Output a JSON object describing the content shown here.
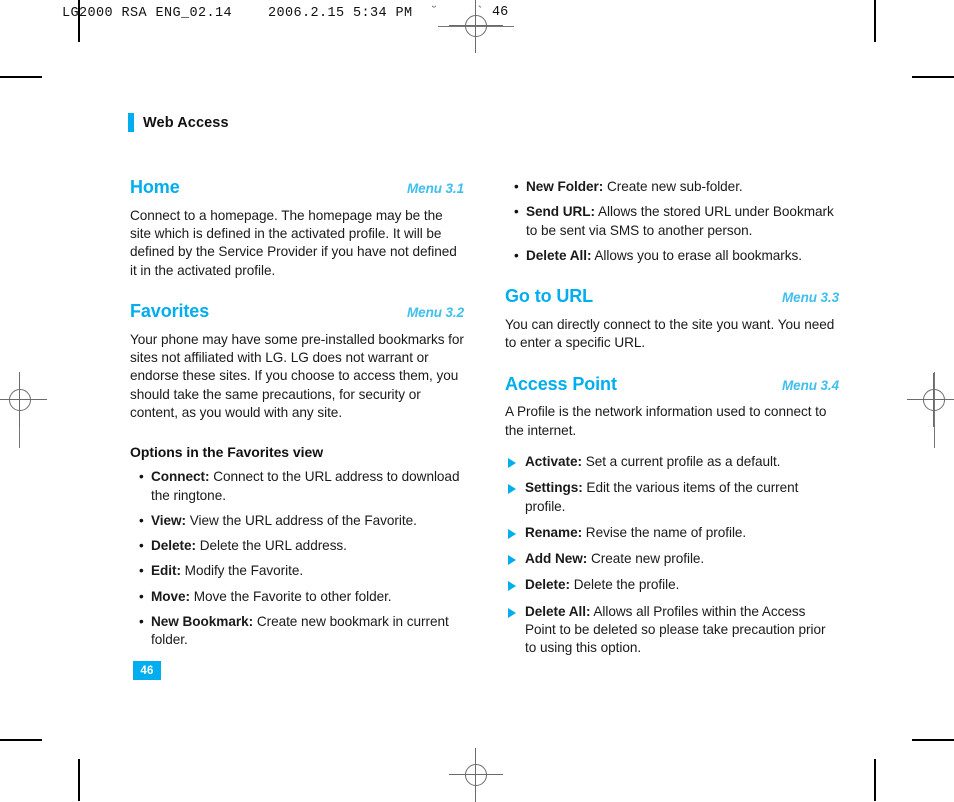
{
  "print_slug": {
    "job": "LG2000 RSA ENG_02.14",
    "timestamp": "2006.2.15 5:34 PM",
    "mark_1": "˘",
    "mark_2": "`",
    "folio": "46"
  },
  "chapter": {
    "title": "Web Access",
    "accent_color": "#00AEEF"
  },
  "page_number": "46",
  "columns": {
    "left": {
      "sections": [
        {
          "title": "Home",
          "menu": "Menu 3.1",
          "paragraphs": [
            "Connect to a homepage. The homepage may be the site which is defined in the activated profile. It will be defined by the Service Provider if you have not defined it in the activated profile."
          ]
        },
        {
          "title": "Favorites",
          "menu": "Menu 3.2",
          "paragraphs": [
            "Your phone may have some pre-installed bookmarks for sites not affiliated with LG. LG does not warrant or endorse these sites. If you choose to access them, you should take the same precautions, for security or content, as you would with any site."
          ],
          "subhead": "Options in the Favorites view",
          "bullet_marker": "•",
          "bullets": [
            {
              "label": "Connect:",
              "text": " Connect to the URL address to download the ringtone."
            },
            {
              "label": "View:",
              "text": " View the URL address of the Favorite."
            },
            {
              "label": "Delete:",
              "text": " Delete the URL address."
            },
            {
              "label": "Edit:",
              "text": " Modify the Favorite."
            },
            {
              "label": "Move:",
              "text": " Move the Favorite to other folder."
            },
            {
              "label": "New Bookmark:",
              "text": " Create new bookmark in current folder."
            }
          ]
        }
      ]
    },
    "right": {
      "continued_bullet_marker": "•",
      "continued_bullets": [
        {
          "label": "New Folder:",
          "text": " Create new sub-folder."
        },
        {
          "label": "Send URL:",
          "text": " Allows the stored URL under Bookmark to be sent via SMS to another person."
        },
        {
          "label": "Delete All:",
          "text": " Allows you to erase all bookmarks."
        }
      ],
      "sections": [
        {
          "title": "Go to URL",
          "menu": "Menu 3.3",
          "paragraphs": [
            "You can directly connect to the site you want. You need to enter a specific URL."
          ]
        },
        {
          "title": "Access Point",
          "menu": "Menu 3.4",
          "paragraphs": [
            "A Profile is the network information used to connect to the internet."
          ],
          "triangle_bullets": [
            {
              "label": "Activate:",
              "text": " Set a current profile as a default."
            },
            {
              "label": "Settings:",
              "text": " Edit the various items of the current profile."
            },
            {
              "label": "Rename:",
              "text": " Revise the name of profile."
            },
            {
              "label": "Add New:",
              "text": " Create new profile."
            },
            {
              "label": "Delete:",
              "text": " Delete the profile."
            },
            {
              "label": "Delete All:",
              "text": " Allows all Profiles within the Access Point to be deleted so please take precaution prior to using this option."
            }
          ]
        }
      ]
    }
  }
}
